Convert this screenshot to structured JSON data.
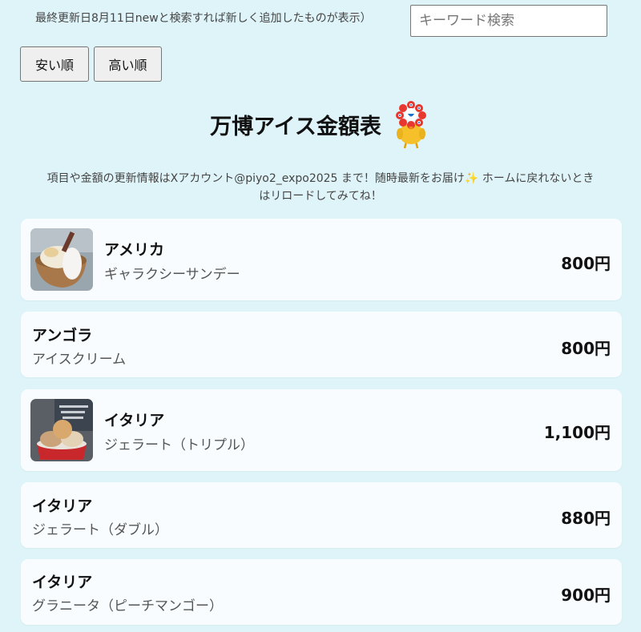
{
  "header": {
    "notice": "最終更新日8月11日newと検索すれば新しく追加したものが表示）",
    "search_placeholder": "キーワード検索",
    "sort_cheap_label": "安い順",
    "sort_expensive_label": "高い順"
  },
  "title": "万博アイス金額表",
  "info_line1": "項目や金額の更新情報はXアカウント@piyo2_expo2025 まで！随時最新をお届け✨ ホームに戻れないとき",
  "info_line2": "はリロードしてみてね！",
  "items": [
    {
      "country": "アメリカ",
      "product": "ギャラクシーサンデー",
      "price": "800円",
      "has_image": true
    },
    {
      "country": "アンゴラ",
      "product": "アイスクリーム",
      "price": "800円",
      "has_image": false
    },
    {
      "country": "イタリア",
      "product": "ジェラート（トリプル）",
      "price": "1,100円",
      "has_image": true
    },
    {
      "country": "イタリア",
      "product": "ジェラート（ダブル）",
      "price": "880円",
      "has_image": false
    },
    {
      "country": "イタリア",
      "product": "グラニータ（ピーチマンゴー）",
      "price": "900円",
      "has_image": false
    }
  ],
  "colors": {
    "background": "#dff4f9",
    "card": "#f8fcfe",
    "mascot_red": "#e8372f",
    "mascot_yellow": "#f5c02a"
  }
}
